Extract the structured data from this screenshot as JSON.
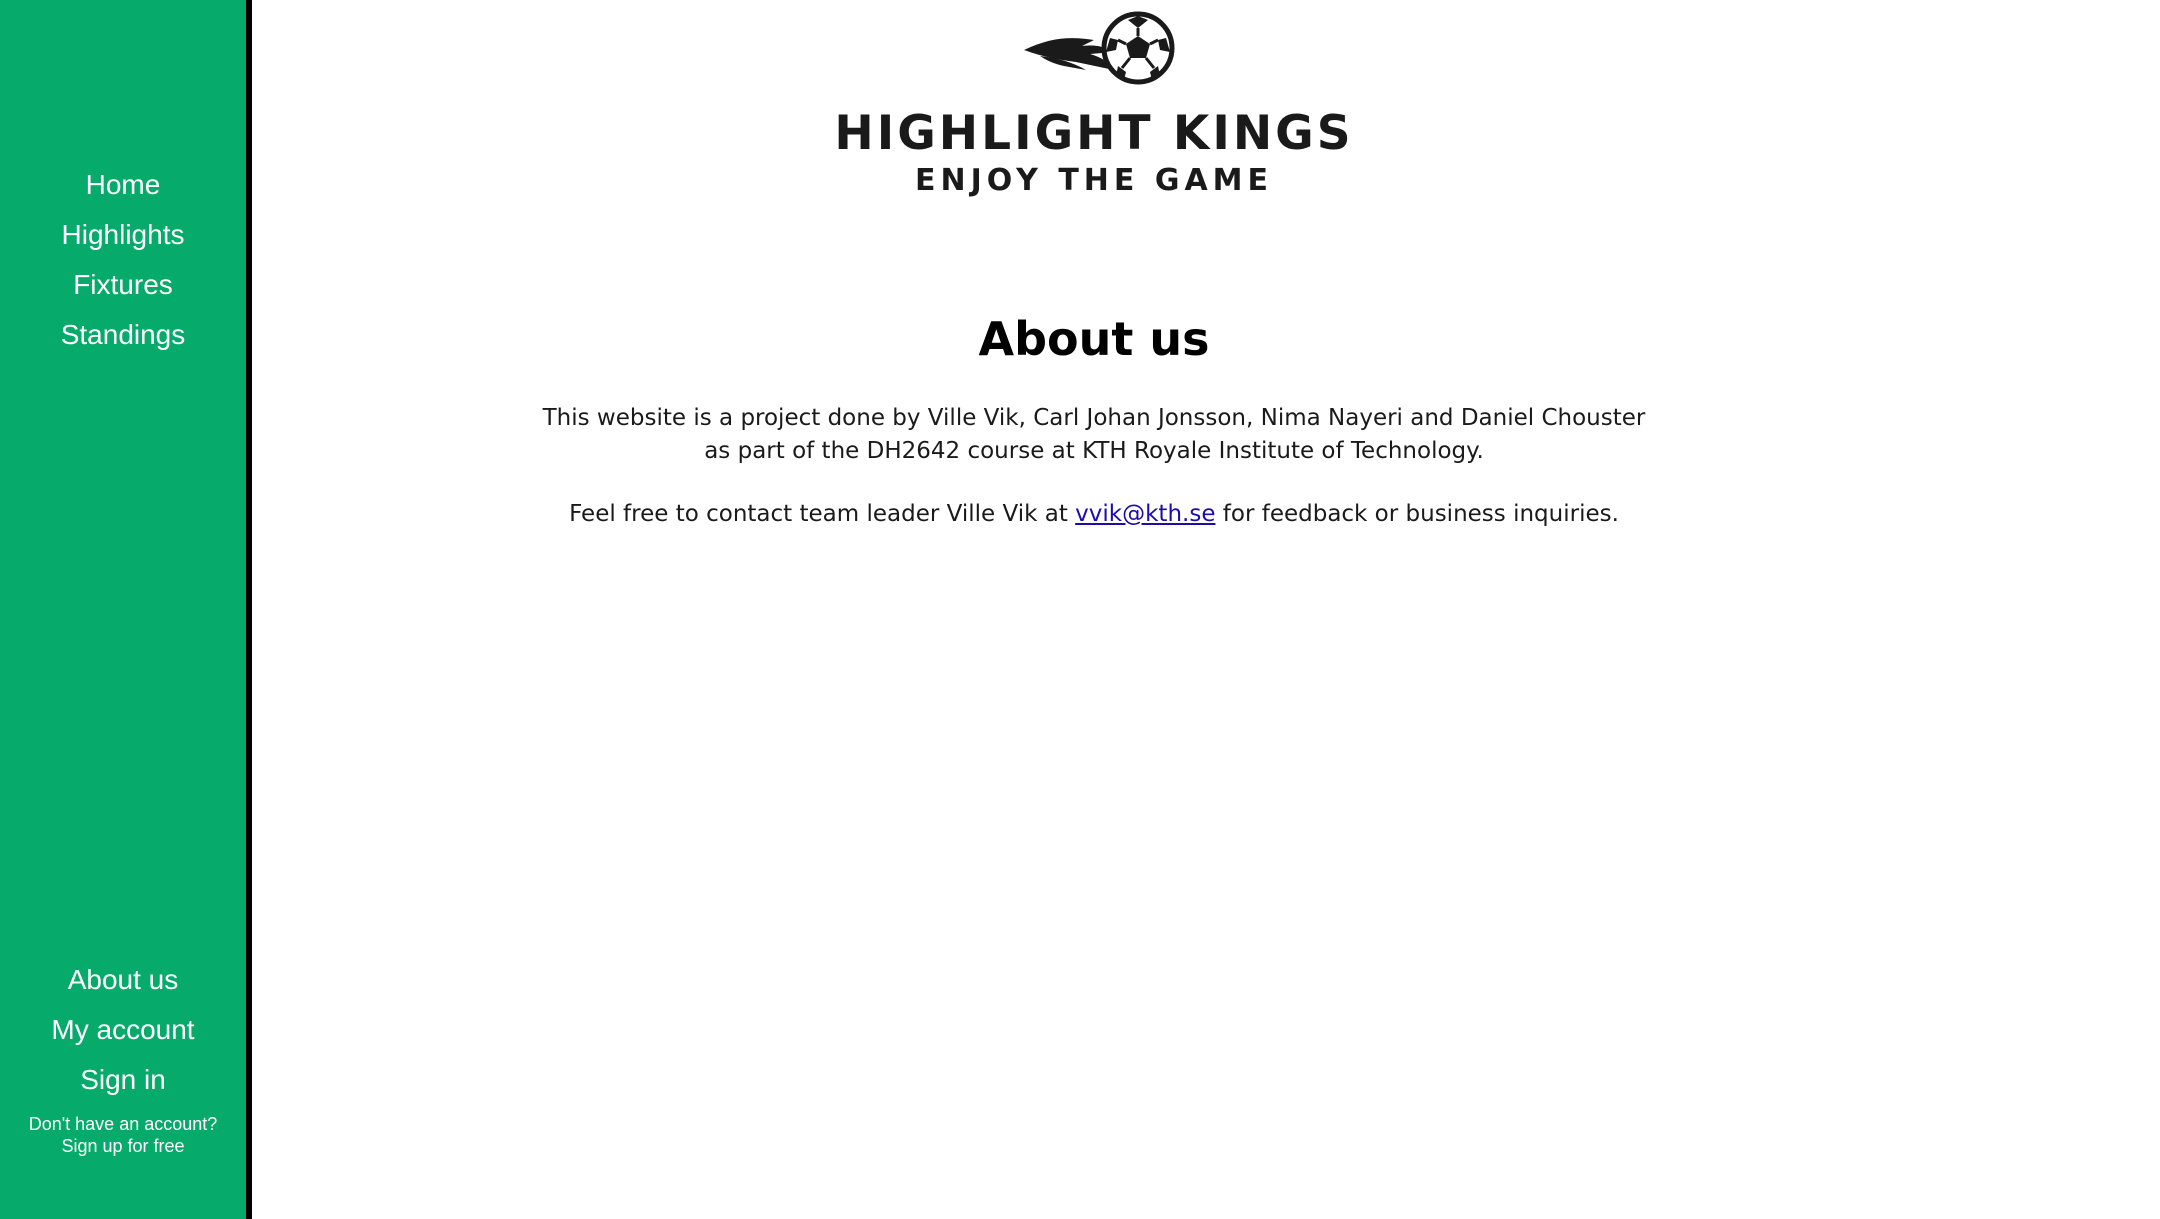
{
  "sidebar": {
    "top_items": [
      {
        "label": "Home"
      },
      {
        "label": "Highlights"
      },
      {
        "label": "Fixtures"
      },
      {
        "label": "Standings"
      }
    ],
    "bottom_items": [
      {
        "label": "About us"
      },
      {
        "label": "My account"
      },
      {
        "label": "Sign in"
      }
    ],
    "signup_line1": "Don't have an account?",
    "signup_line2": "Sign up for free"
  },
  "logo": {
    "title": "HIGHLIGHT KINGS",
    "subtitle": "ENJOY THE GAME",
    "icon": "soccer-ball-icon"
  },
  "main": {
    "heading": "About us",
    "paragraph1": "This website is a project done by Ville Vik, Carl Johan Jonsson, Nima Nayeri and Daniel Chouster as part of the DH2642 course at KTH Royale Institute of Technology.",
    "paragraph2_before": "Feel free to contact team leader Ville Vik at ",
    "email": "vvik@kth.se",
    "paragraph2_after": " for feedback or business inquiries."
  },
  "colors": {
    "sidebar": "#06aa6b",
    "sidebar_border": "#000000",
    "link": "#1a0dab"
  }
}
